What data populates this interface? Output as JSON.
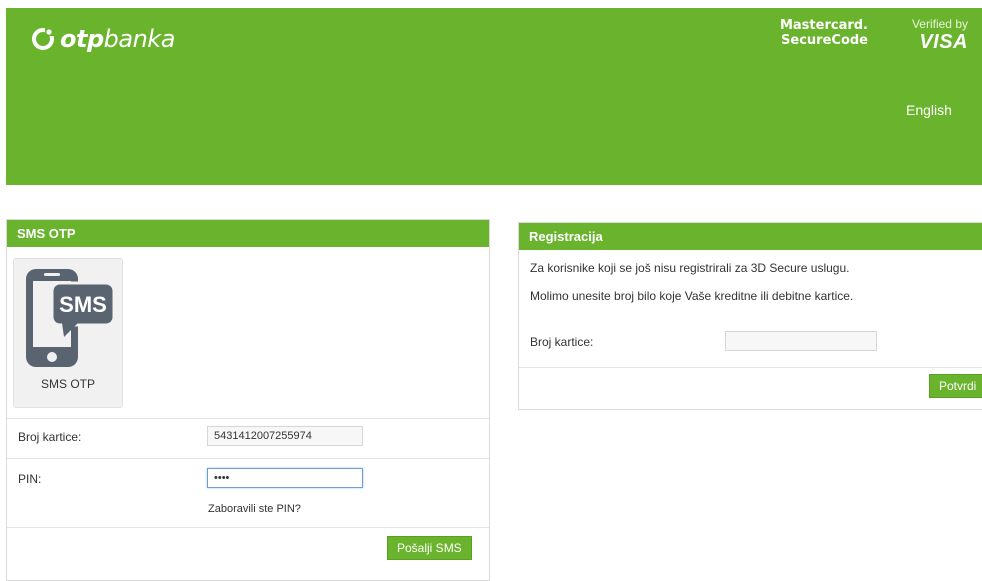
{
  "header": {
    "logo": {
      "icon": "otp-logo-icon",
      "bold": "otp",
      "light": "banka"
    },
    "mastercard": {
      "line1": "Mastercard.",
      "line2": "SecureCode"
    },
    "visa": {
      "line1": "Verified by",
      "line2": "VISA"
    },
    "language": "English",
    "color": "#6ab42d"
  },
  "sms_panel": {
    "title": "SMS OTP",
    "tile": {
      "icon_text": "SMS",
      "label": "SMS OTP",
      "icon": "sms-phone-icon"
    },
    "card_label": "Broj kartice:",
    "card_value": "5431412007255974",
    "pin_label": "PIN:",
    "pin_value": "••••",
    "forgot_pin": "Zaboravili ste PIN?",
    "submit": "Pošalji SMS"
  },
  "reg_panel": {
    "title": "Registracija",
    "line1": "Za korisnike koji se još nisu registrirali za 3D Secure uslugu.",
    "line2": "Molimo unesite broj bilo koje Vaše kreditne ili debitne kartice.",
    "card_label": "Broj kartice:",
    "card_value": "",
    "submit": "Potvrdi"
  }
}
